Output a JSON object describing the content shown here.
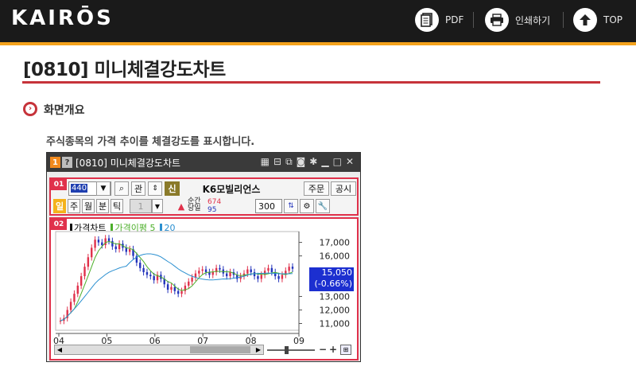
{
  "header": {
    "logo": "KAIRŌS",
    "pdf_label": "PDF",
    "print_label": "인쇄하기",
    "top_label": "TOP"
  },
  "page": {
    "title": "[0810] 미니체결강도차트",
    "section_label": "화면개요",
    "description": "주식종목의 가격 추이를 체결강도를 표시합니다."
  },
  "window": {
    "num_badge": "1",
    "help_badge": "?",
    "title": "[0810] 미니체결강도차트",
    "panel1_badge": "01",
    "panel2_badge": "02",
    "code_value": "440",
    "btn_gwan": "관",
    "btn_sin": "신",
    "stock_name": "K6모빌리언스",
    "btn_order": "주문",
    "btn_notice": "공시",
    "period_il": "일",
    "period_ju": "주",
    "period_wol": "월",
    "period_bun": "분",
    "period_tik": "틱",
    "period_select": "1",
    "strength_label_top": "순간",
    "strength_label_bottom": "당일",
    "strength_val_top": "674",
    "strength_val_bottom": "95",
    "count_value": "300",
    "legend_price": "가격차트",
    "legend_ma5": "가격이평 5",
    "legend_ma20": "20",
    "price_current": "15,050",
    "price_change": "(-0.66%)"
  },
  "chart_data": {
    "type": "candlestick",
    "x_ticks": [
      "04",
      "05",
      "06",
      "07",
      "08",
      "09"
    ],
    "y_ticks": [
      "17,000",
      "16,000",
      "13,000",
      "12,000",
      "11,000"
    ],
    "ylim": [
      10500,
      17800
    ],
    "series": [
      {
        "name": "가격차트",
        "color": "#1a1a1a"
      },
      {
        "name": "가격이평 5",
        "color": "#4caf2a"
      },
      {
        "name": "20",
        "color": "#2a8fd0"
      }
    ],
    "colors": {
      "up": "#e0314b",
      "down": "#2233bb"
    }
  }
}
